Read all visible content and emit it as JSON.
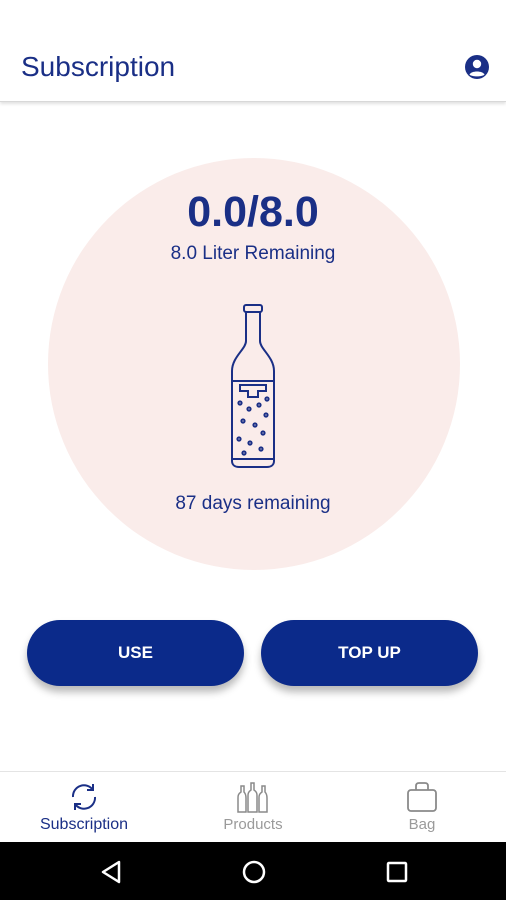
{
  "appbar": {
    "title": "Subscription",
    "account_icon": "account-circle-icon"
  },
  "subscription": {
    "usage": "0.0/8.0",
    "liters_remaining": "8.0 Liter Remaining",
    "days_remaining": "87 days remaining",
    "bottle_icon": "bottle-icon"
  },
  "actions": {
    "use_label": "USE",
    "topup_label": "TOP UP"
  },
  "bottom_nav": {
    "items": [
      {
        "label": "Subscription",
        "icon": "sync-icon",
        "active": true
      },
      {
        "label": "Products",
        "icon": "bottles-icon",
        "active": false
      },
      {
        "label": "Bag",
        "icon": "bag-icon",
        "active": false
      }
    ]
  },
  "system_nav": {
    "icons": [
      "back-icon",
      "home-icon",
      "recents-icon"
    ]
  },
  "colors": {
    "primary": "#1a2f86",
    "button": "#0b2a8a",
    "circle_bg": "#faecea",
    "inactive": "#9a9a9a"
  }
}
